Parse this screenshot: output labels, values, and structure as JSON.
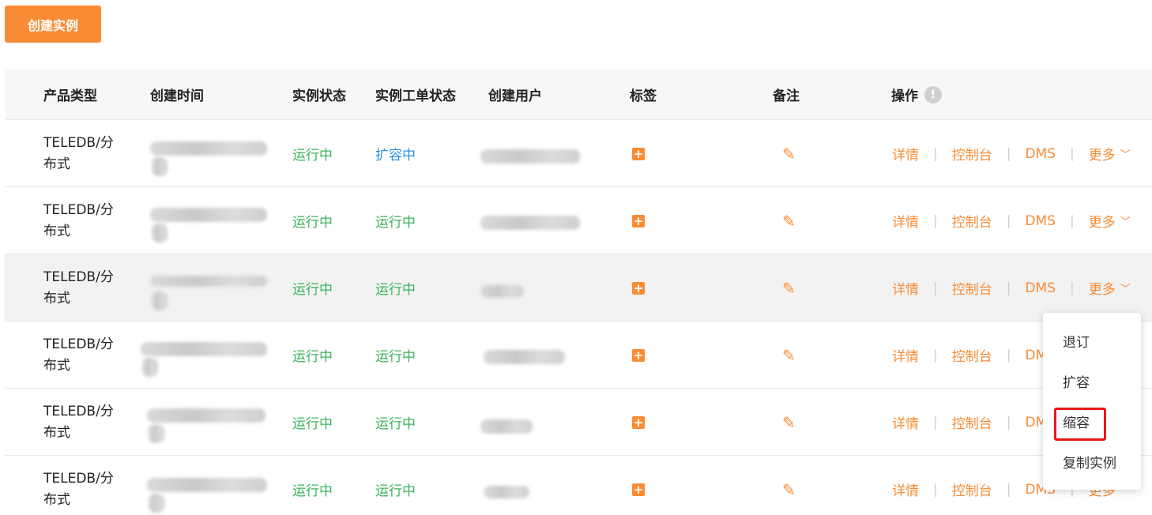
{
  "toolbar": {
    "create_label": "创建实例"
  },
  "columns": {
    "product_type": "产品类型",
    "create_time": "创建时间",
    "instance_status": "实例状态",
    "order_status": "实例工单状态",
    "create_user": "创建用户",
    "tags": "标签",
    "remark": "备注",
    "actions": "操作"
  },
  "icons": {
    "info": "info-icon",
    "tag_add": "plus-square-icon",
    "edit": "pencil-icon",
    "chevron": "chevron-down-icon"
  },
  "colors": {
    "accent": "#fa8c35",
    "running": "#3bb45a",
    "scaling": "#2f8fe0"
  },
  "rows": [
    {
      "type_line1": "TELEDB/分",
      "type_line2": "布式",
      "status": "运行中",
      "order_status": "扩容中"
    },
    {
      "type_line1": "TELEDB/分",
      "type_line2": "布式",
      "status": "运行中",
      "order_status": "运行中"
    },
    {
      "type_line1": "TELEDB/分",
      "type_line2": "布式",
      "status": "运行中",
      "order_status": "运行中"
    },
    {
      "type_line1": "TELEDB/分",
      "type_line2": "布式",
      "status": "运行中",
      "order_status": "运行中"
    },
    {
      "type_line1": "TELEDB/分",
      "type_line2": "布式",
      "status": "运行中",
      "order_status": "运行中"
    },
    {
      "type_line1": "TELEDB/分",
      "type_line2": "布式",
      "status": "运行中",
      "order_status": "运行中"
    }
  ],
  "ops": {
    "detail": "详情",
    "console": "控制台",
    "dms": "DMS",
    "more": "更多",
    "sep": "|"
  },
  "dropdown": {
    "items": [
      "退订",
      "扩容",
      "缩容",
      "复制实例"
    ]
  }
}
